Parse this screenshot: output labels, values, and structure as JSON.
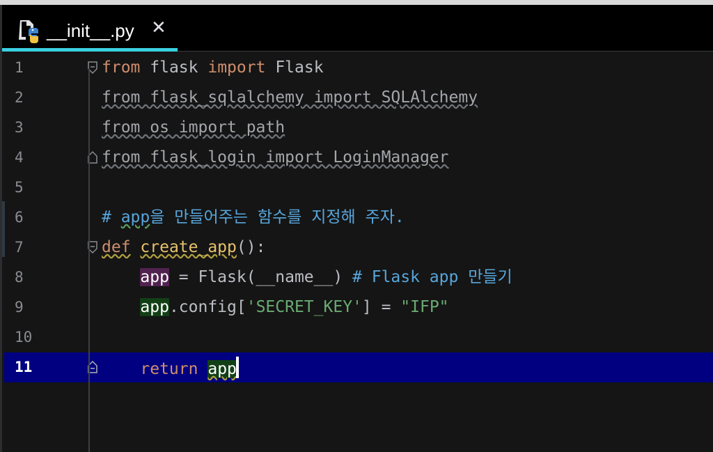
{
  "tab": {
    "filename": "__init__.py",
    "close_glyph": "✕",
    "icon": "python-file-icon",
    "accent": "#3ad0e0"
  },
  "editor": {
    "current_line": "11",
    "lines": [
      {
        "num": "1",
        "tokens": [
          "from",
          "flask",
          "import",
          "Flask"
        ]
      },
      {
        "num": "2",
        "text": "from flask_sqlalchemy import SQLAlchemy"
      },
      {
        "num": "3",
        "text": "from os import path"
      },
      {
        "num": "4",
        "text": "from flask_login import LoginManager"
      },
      {
        "num": "5"
      },
      {
        "num": "6",
        "comment_prefix": "# ",
        "comment_app": "app",
        "comment_rest": "을 만들어주는 함수를 지정해 주자."
      },
      {
        "num": "7",
        "kw": "def",
        "fn": "create_app",
        "rest": "():"
      },
      {
        "num": "8",
        "var": "app",
        "mid": " = Flask(__name__)",
        "comment": " # Flask app 만들기"
      },
      {
        "num": "9",
        "var": "app",
        "mid": ".config[",
        "str": "'SECRET_KEY'",
        "mid2": "] = ",
        "str2": "\"IFP\""
      },
      {
        "num": "10"
      },
      {
        "num": "11",
        "kw": "return",
        "var": "app"
      }
    ]
  },
  "colors": {
    "keyword": "#cf8e6d",
    "string": "#6aab73",
    "comment": "#57a6dc",
    "function": "#e7c26c",
    "current_line": "#000080"
  }
}
